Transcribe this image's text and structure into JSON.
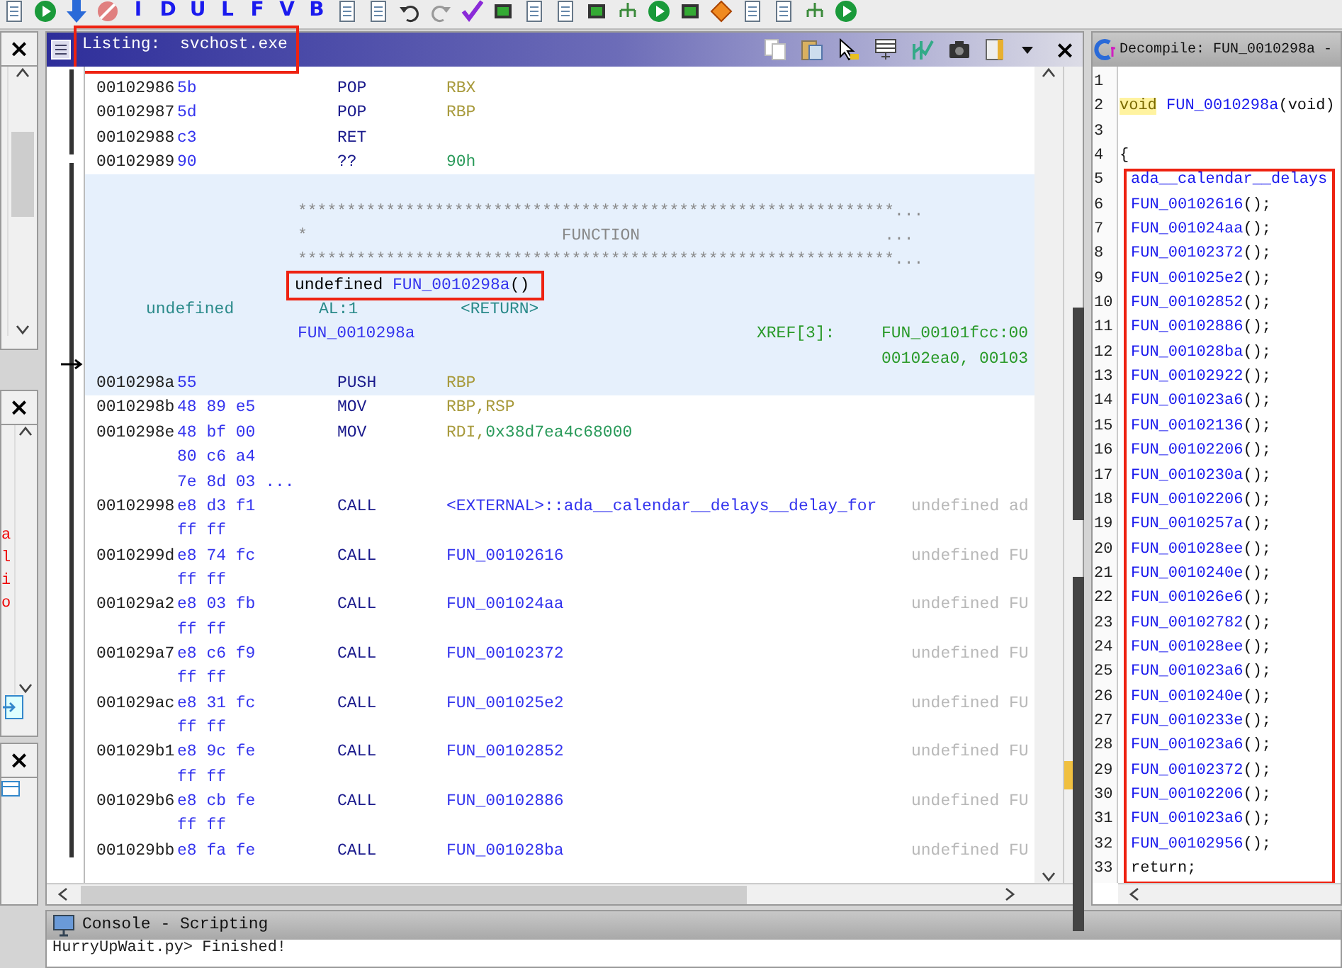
{
  "toolbar": {
    "letters": [
      "I",
      "D",
      "U",
      "L",
      "F",
      "V",
      "B"
    ]
  },
  "side_panel": {
    "close_buttons": [
      "×",
      "×",
      "×"
    ],
    "fragments": [
      "a",
      "l",
      "i",
      "o"
    ]
  },
  "listing": {
    "title": "Listing:",
    "program": "svchost.exe",
    "annotated": true,
    "close": "×",
    "rows": [
      {
        "kind": "code",
        "highlighted": false,
        "address": "00102986",
        "bytes": "5b",
        "mnemonic": "POP",
        "operands": [
          {
            "text": "RBX",
            "kind": "register"
          }
        ]
      },
      {
        "kind": "code",
        "highlighted": false,
        "address": "00102987",
        "bytes": "5d",
        "mnemonic": "POP",
        "operands": [
          {
            "text": "RBP",
            "kind": "register"
          }
        ]
      },
      {
        "kind": "code",
        "highlighted": false,
        "address": "00102988",
        "bytes": "c3",
        "mnemonic": "RET"
      },
      {
        "kind": "code",
        "highlighted": false,
        "address": "00102989",
        "bytes": "90",
        "mnemonic": "??",
        "operands": [
          {
            "text": "90h",
            "kind": "scalar"
          }
        ]
      },
      {
        "kind": "blank",
        "highlighted": true
      },
      {
        "kind": "plate",
        "highlighted": true,
        "text": "*************************************************************..."
      },
      {
        "kind": "plate",
        "highlighted": true,
        "text": "*                          FUNCTION                         ..."
      },
      {
        "kind": "plate",
        "highlighted": true,
        "text": "*************************************************************..."
      },
      {
        "kind": "signature",
        "highlighted": true,
        "annotated": true,
        "return_type": "undefined",
        "name": "FUN_0010298a",
        "params": "()"
      },
      {
        "kind": "return",
        "highlighted": true,
        "type": "undefined",
        "storage": "AL:1",
        "name": "<RETURN>"
      },
      {
        "kind": "label",
        "highlighted": true,
        "name": "FUN_0010298a",
        "xref_label": "XREF[3]:",
        "xref": "FUN_00101fcc:00"
      },
      {
        "kind": "xref",
        "highlighted": true,
        "text": "00102ea0, 00103"
      },
      {
        "kind": "code",
        "highlighted": true,
        "address": "0010298a",
        "bytes": "55",
        "mnemonic": "PUSH",
        "operands": [
          {
            "text": "RBP",
            "kind": "register"
          }
        ]
      },
      {
        "kind": "code",
        "highlighted": false,
        "address": "0010298b",
        "bytes": "48 89 e5",
        "mnemonic": "MOV",
        "operands": [
          {
            "text": "RBP,RSP",
            "kind": "register"
          }
        ]
      },
      {
        "kind": "code",
        "highlighted": false,
        "address": "0010298e",
        "bytes": "48 bf 00",
        "mnemonic": "MOV",
        "operands": [
          {
            "text": "RDI,",
            "kind": "register"
          },
          {
            "text": "0x38d7ea4c68000",
            "kind": "scalar"
          }
        ]
      },
      {
        "kind": "bytes",
        "highlighted": false,
        "bytes": "80 c6 a4"
      },
      {
        "kind": "bytes",
        "highlighted": false,
        "bytes": "7e 8d 03 ..."
      },
      {
        "kind": "code",
        "highlighted": false,
        "address": "00102998",
        "bytes": "e8 d3 f1",
        "mnemonic": "CALL",
        "operands": [
          {
            "text": "<EXTERNAL>::ada__calendar__delays__delay_for",
            "kind": "label"
          }
        ],
        "comment": "undefined ad"
      },
      {
        "kind": "bytes",
        "highlighted": false,
        "bytes": "ff ff"
      },
      {
        "kind": "code",
        "highlighted": false,
        "address": "0010299d",
        "bytes": "e8 74 fc",
        "mnemonic": "CALL",
        "operands": [
          {
            "text": "FUN_00102616",
            "kind": "label"
          }
        ],
        "comment": "undefined FU"
      },
      {
        "kind": "bytes",
        "highlighted": false,
        "bytes": "ff ff"
      },
      {
        "kind": "code",
        "highlighted": false,
        "address": "001029a2",
        "bytes": "e8 03 fb",
        "mnemonic": "CALL",
        "operands": [
          {
            "text": "FUN_001024aa",
            "kind": "label"
          }
        ],
        "comment": "undefined FU"
      },
      {
        "kind": "bytes",
        "highlighted": false,
        "bytes": "ff ff"
      },
      {
        "kind": "code",
        "highlighted": false,
        "address": "001029a7",
        "bytes": "e8 c6 f9",
        "mnemonic": "CALL",
        "operands": [
          {
            "text": "FUN_00102372",
            "kind": "label"
          }
        ],
        "comment": "undefined FU"
      },
      {
        "kind": "bytes",
        "highlighted": false,
        "bytes": "ff ff"
      },
      {
        "kind": "code",
        "highlighted": false,
        "address": "001029ac",
        "bytes": "e8 31 fc",
        "mnemonic": "CALL",
        "operands": [
          {
            "text": "FUN_001025e2",
            "kind": "label"
          }
        ],
        "comment": "undefined FU"
      },
      {
        "kind": "bytes",
        "highlighted": false,
        "bytes": "ff ff"
      },
      {
        "kind": "code",
        "highlighted": false,
        "address": "001029b1",
        "bytes": "e8 9c fe",
        "mnemonic": "CALL",
        "operands": [
          {
            "text": "FUN_00102852",
            "kind": "label"
          }
        ],
        "comment": "undefined FU"
      },
      {
        "kind": "bytes",
        "highlighted": false,
        "bytes": "ff ff"
      },
      {
        "kind": "code",
        "highlighted": false,
        "address": "001029b6",
        "bytes": "e8 cb fe",
        "mnemonic": "CALL",
        "operands": [
          {
            "text": "FUN_00102886",
            "kind": "label"
          }
        ],
        "comment": "undefined FU"
      },
      {
        "kind": "bytes",
        "highlighted": false,
        "bytes": "ff ff"
      },
      {
        "kind": "code",
        "highlighted": false,
        "address": "001029bb",
        "bytes": "e8 fa fe",
        "mnemonic": "CALL",
        "operands": [
          {
            "text": "FUN_001028ba",
            "kind": "label"
          }
        ],
        "comment": "undefined FU"
      }
    ]
  },
  "decompile": {
    "title": "Decompile: FUN_0010298a -",
    "groups": [
      {
        "boxed": false,
        "lines": [
          {
            "number": "1"
          },
          {
            "number": "2",
            "parts": [
              {
                "text": "void",
                "kind": "keyword",
                "highlighted": true
              },
              {
                "text": "FUN_0010298a",
                "kind": "function"
              },
              {
                "text": "(void)",
                "kind": "plain"
              }
            ]
          },
          {
            "number": "3"
          },
          {
            "number": "4",
            "parts": [
              {
                "text": "{",
                "kind": "plain"
              }
            ]
          }
        ]
      },
      {
        "boxed": true,
        "lines": [
          {
            "number": "5",
            "parts": [
              {
                "text": "ada__calendar__delays",
                "kind": "function"
              }
            ]
          },
          {
            "number": "6",
            "parts": [
              {
                "text": "FUN_00102616",
                "kind": "function"
              },
              {
                "text": "();",
                "kind": "plain"
              }
            ]
          },
          {
            "number": "7",
            "parts": [
              {
                "text": "FUN_001024aa",
                "kind": "function"
              },
              {
                "text": "();",
                "kind": "plain"
              }
            ]
          },
          {
            "number": "8",
            "parts": [
              {
                "text": "FUN_00102372",
                "kind": "function"
              },
              {
                "text": "();",
                "kind": "plain"
              }
            ]
          },
          {
            "number": "9",
            "parts": [
              {
                "text": "FUN_001025e2",
                "kind": "function"
              },
              {
                "text": "();",
                "kind": "plain"
              }
            ]
          },
          {
            "number": "10",
            "parts": [
              {
                "text": "FUN_00102852",
                "kind": "function"
              },
              {
                "text": "();",
                "kind": "plain"
              }
            ]
          },
          {
            "number": "11",
            "parts": [
              {
                "text": "FUN_00102886",
                "kind": "function"
              },
              {
                "text": "();",
                "kind": "plain"
              }
            ]
          },
          {
            "number": "12",
            "parts": [
              {
                "text": "FUN_001028ba",
                "kind": "function"
              },
              {
                "text": "();",
                "kind": "plain"
              }
            ]
          },
          {
            "number": "13",
            "parts": [
              {
                "text": "FUN_00102922",
                "kind": "function"
              },
              {
                "text": "();",
                "kind": "plain"
              }
            ]
          },
          {
            "number": "14",
            "parts": [
              {
                "text": "FUN_001023a6",
                "kind": "function"
              },
              {
                "text": "();",
                "kind": "plain"
              }
            ]
          },
          {
            "number": "15",
            "parts": [
              {
                "text": "FUN_00102136",
                "kind": "function"
              },
              {
                "text": "();",
                "kind": "plain"
              }
            ]
          },
          {
            "number": "16",
            "parts": [
              {
                "text": "FUN_00102206",
                "kind": "function"
              },
              {
                "text": "();",
                "kind": "plain"
              }
            ]
          },
          {
            "number": "17",
            "parts": [
              {
                "text": "FUN_0010230a",
                "kind": "function"
              },
              {
                "text": "();",
                "kind": "plain"
              }
            ]
          },
          {
            "number": "18",
            "parts": [
              {
                "text": "FUN_00102206",
                "kind": "function"
              },
              {
                "text": "();",
                "kind": "plain"
              }
            ]
          },
          {
            "number": "19",
            "parts": [
              {
                "text": "FUN_0010257a",
                "kind": "function"
              },
              {
                "text": "();",
                "kind": "plain"
              }
            ]
          },
          {
            "number": "20",
            "parts": [
              {
                "text": "FUN_001028ee",
                "kind": "function"
              },
              {
                "text": "();",
                "kind": "plain"
              }
            ]
          },
          {
            "number": "21",
            "parts": [
              {
                "text": "FUN_0010240e",
                "kind": "function"
              },
              {
                "text": "();",
                "kind": "plain"
              }
            ]
          },
          {
            "number": "22",
            "parts": [
              {
                "text": "FUN_001026e6",
                "kind": "function"
              },
              {
                "text": "();",
                "kind": "plain"
              }
            ]
          },
          {
            "number": "23",
            "parts": [
              {
                "text": "FUN_00102782",
                "kind": "function"
              },
              {
                "text": "();",
                "kind": "plain"
              }
            ]
          },
          {
            "number": "24",
            "parts": [
              {
                "text": "FUN_001028ee",
                "kind": "function"
              },
              {
                "text": "();",
                "kind": "plain"
              }
            ]
          },
          {
            "number": "25",
            "parts": [
              {
                "text": "FUN_001023a6",
                "kind": "function"
              },
              {
                "text": "();",
                "kind": "plain"
              }
            ]
          },
          {
            "number": "26",
            "parts": [
              {
                "text": "FUN_0010240e",
                "kind": "function"
              },
              {
                "text": "();",
                "kind": "plain"
              }
            ]
          },
          {
            "number": "27",
            "parts": [
              {
                "text": "FUN_0010233e",
                "kind": "function"
              },
              {
                "text": "();",
                "kind": "plain"
              }
            ]
          },
          {
            "number": "28",
            "parts": [
              {
                "text": "FUN_001023a6",
                "kind": "function"
              },
              {
                "text": "();",
                "kind": "plain"
              }
            ]
          },
          {
            "number": "29",
            "parts": [
              {
                "text": "FUN_00102372",
                "kind": "function"
              },
              {
                "text": "();",
                "kind": "plain"
              }
            ]
          },
          {
            "number": "30",
            "parts": [
              {
                "text": "FUN_00102206",
                "kind": "function"
              },
              {
                "text": "();",
                "kind": "plain"
              }
            ]
          },
          {
            "number": "31",
            "parts": [
              {
                "text": "FUN_001023a6",
                "kind": "function"
              },
              {
                "text": "();",
                "kind": "plain"
              }
            ]
          },
          {
            "number": "32",
            "parts": [
              {
                "text": "FUN_00102956",
                "kind": "function"
              },
              {
                "text": "();",
                "kind": "plain"
              }
            ]
          },
          {
            "number": "33",
            "parts": [
              {
                "text": "return;",
                "kind": "plain"
              }
            ]
          }
        ]
      }
    ]
  },
  "console": {
    "title": "Console - Scripting",
    "lines": [
      "HurryUpWait.py> Finished!"
    ]
  }
}
